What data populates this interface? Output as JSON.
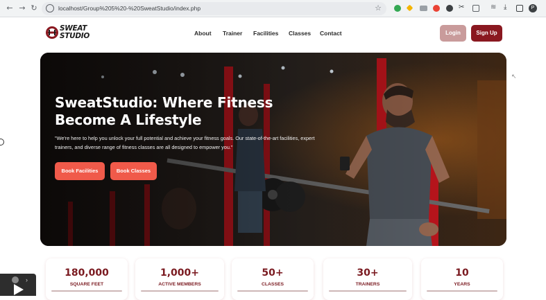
{
  "browser": {
    "back_icon": "←",
    "forward_icon": "→",
    "reload_icon": "↻",
    "url": "localhost/Group%205%20-%20SweatStudio/index.php",
    "bookmark_icon": "☆",
    "avatar_letter": "P"
  },
  "logo": {
    "line1": "SWEAT",
    "line2": "STUDIO"
  },
  "nav": {
    "items": [
      {
        "label": "About"
      },
      {
        "label": "Trainer"
      },
      {
        "label": "Facilities"
      },
      {
        "label": "Classes"
      },
      {
        "label": "Contact"
      }
    ],
    "login_label": "Login",
    "signup_label": "Sign Up"
  },
  "hero": {
    "title_line1": "SweatStudio: Where Fitness",
    "title_line2": "Become A Lifestyle",
    "subtitle": "\"We're here to help you unlock your full potential and achieve your fitness goals. Our state-of-the-art facilities, expert trainers, and diverse range of fitness classes are all designed to empower you.\"",
    "btn_facilities": "Book Facilities",
    "btn_classes": "Book Classes"
  },
  "stats": [
    {
      "value": "180,000",
      "label": "SQUARE FEET"
    },
    {
      "value": "1,000+",
      "label": "ACTIVE MEMBERS"
    },
    {
      "value": "50+",
      "label": "CLASSES"
    },
    {
      "value": "30+",
      "label": "TRAINERS"
    },
    {
      "value": "10",
      "label": "YEARS"
    }
  ],
  "colors": {
    "brand_dark": "#8a1820",
    "brand_muted": "#c99b9b",
    "accent": "#f05a4a",
    "stat_text": "#7a1a20"
  }
}
